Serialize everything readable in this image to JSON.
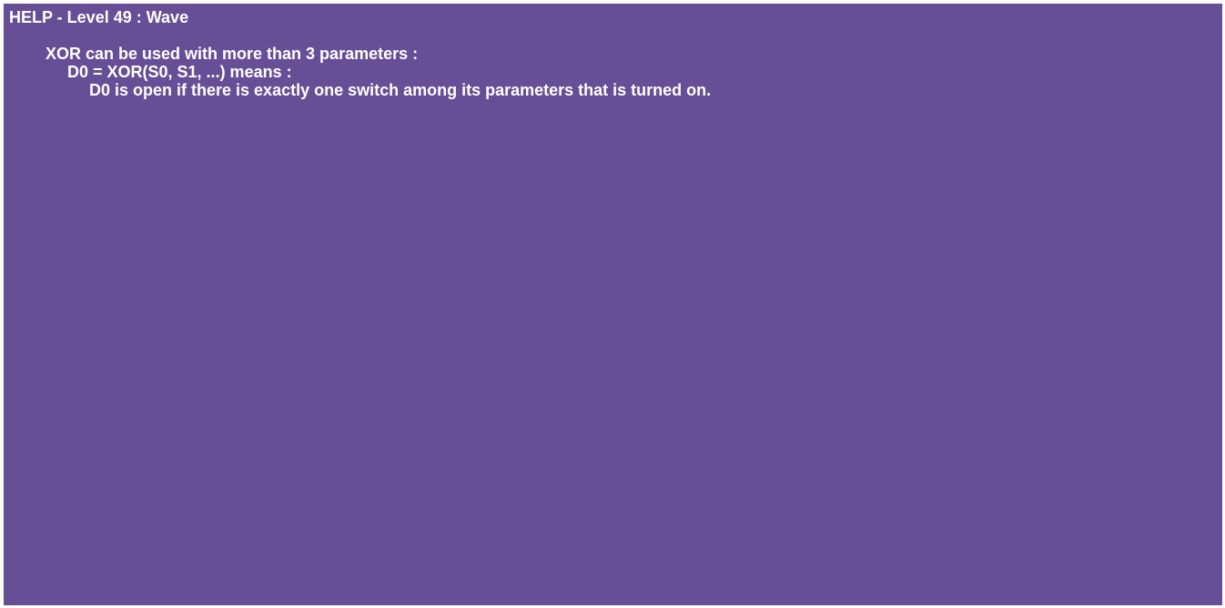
{
  "help": {
    "title": "HELP - Level 49 : Wave",
    "lines": [
      "XOR can be used with more than 3 parameters :",
      "D0 = XOR(S0, S1, ...) means :",
      "D0 is open if there is exactly one switch among its parameters that is turned on."
    ]
  },
  "colors": {
    "background": "#664f96",
    "text": "#ffffff"
  }
}
